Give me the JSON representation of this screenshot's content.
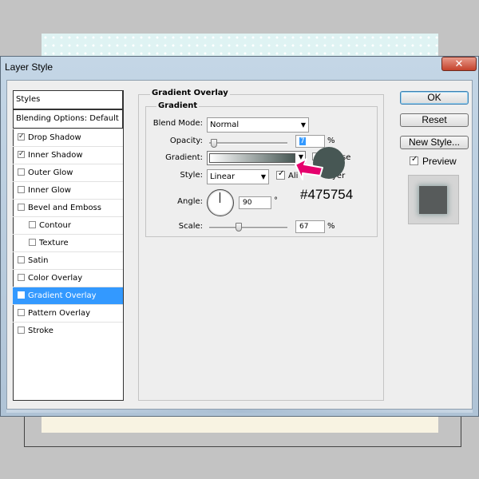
{
  "dialog": {
    "title": "Layer Style",
    "close_glyph": "✕"
  },
  "styles_list": {
    "header": "Styles",
    "blending": "Blending Options: Default",
    "items": [
      {
        "label": "Drop Shadow",
        "checked": true,
        "indent": false
      },
      {
        "label": "Inner Shadow",
        "checked": true,
        "indent": false
      },
      {
        "label": "Outer Glow",
        "checked": false,
        "indent": false
      },
      {
        "label": "Inner Glow",
        "checked": false,
        "indent": false
      },
      {
        "label": "Bevel and Emboss",
        "checked": false,
        "indent": false
      },
      {
        "label": "Contour",
        "checked": false,
        "indent": true
      },
      {
        "label": "Texture",
        "checked": false,
        "indent": true
      },
      {
        "label": "Satin",
        "checked": false,
        "indent": false
      },
      {
        "label": "Color Overlay",
        "checked": false,
        "indent": false
      },
      {
        "label": "Gradient Overlay",
        "checked": true,
        "indent": false,
        "selected": true
      },
      {
        "label": "Pattern Overlay",
        "checked": false,
        "indent": false
      },
      {
        "label": "Stroke",
        "checked": false,
        "indent": false
      }
    ]
  },
  "gradient_overlay": {
    "group_title": "Gradient Overlay",
    "sub_title": "Gradient",
    "blend_mode_label": "Blend Mode:",
    "blend_mode_value": "Normal",
    "opacity_label": "Opacity:",
    "opacity_value": "7",
    "opacity_unit": "%",
    "gradient_label": "Gradient:",
    "reverse_label": "se",
    "style_label": "Style:",
    "style_value": "Linear",
    "align_label": "Ali",
    "align_tail": "yer",
    "angle_label": "Angle:",
    "angle_value": "90",
    "angle_unit": "°",
    "scale_label": "Scale:",
    "scale_value": "67",
    "scale_unit": "%"
  },
  "buttons": {
    "ok": "OK",
    "reset": "Reset",
    "new_style": "New Style...",
    "preview": "Preview"
  },
  "annotation": {
    "hex": "#475754",
    "color": "#475754"
  },
  "colors": {
    "selected_row": "#3399ff",
    "gradient_end": "#475754",
    "arrow": "#e5006d"
  }
}
